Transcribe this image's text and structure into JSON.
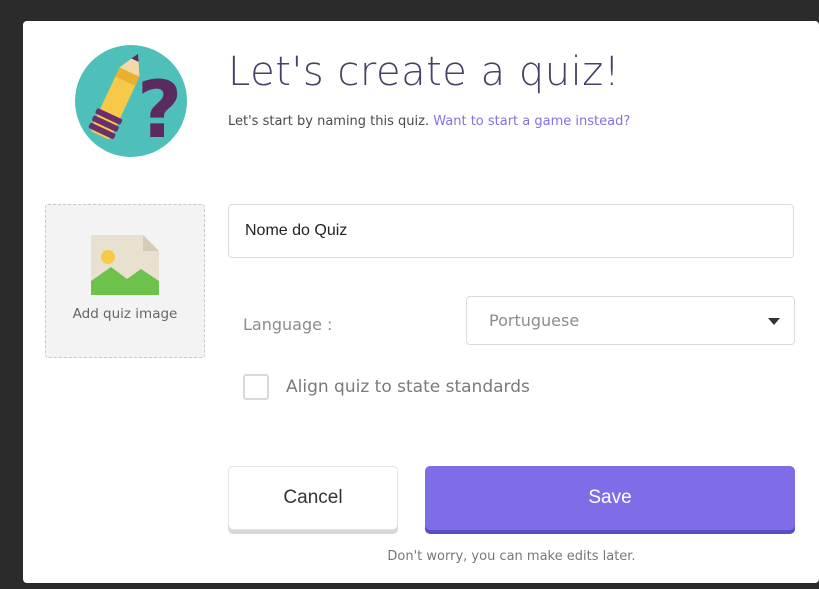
{
  "header": {
    "title": "Let's create a quiz!",
    "subtitle_text": "Let's start by naming this quiz.",
    "subtitle_link": "Want to start a game instead?"
  },
  "image_upload": {
    "label": "Add quiz image",
    "icon": "image-placeholder-icon"
  },
  "form": {
    "name_value": "Nome do Quiz",
    "language_label": "Language :",
    "language_value": "Portuguese",
    "standards_label": "Align quiz to state standards",
    "standards_checked": false
  },
  "actions": {
    "cancel_label": "Cancel",
    "save_label": "Save",
    "footnote": "Don't worry, you can make edits later."
  },
  "colors": {
    "accent": "#7d6ee8",
    "title": "#4a3f66",
    "link": "#8a6fe0",
    "logo_bg": "#4fbfb9",
    "logo_question": "#5b2a5e"
  }
}
